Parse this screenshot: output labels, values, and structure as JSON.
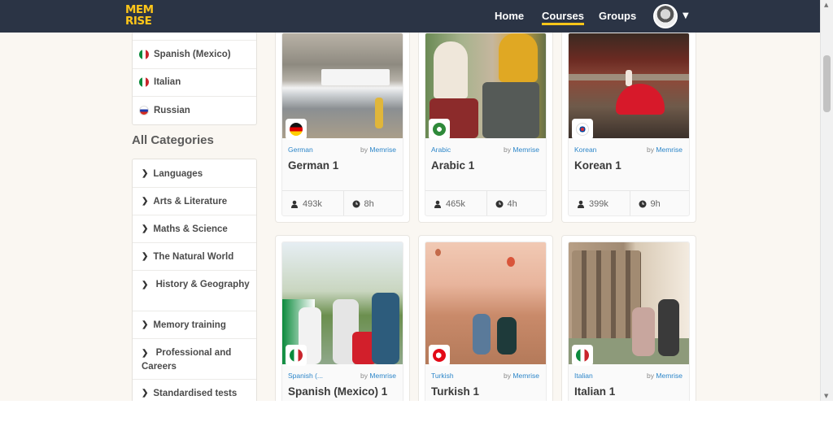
{
  "header": {
    "logo": "MEM RISE",
    "logo_top": "MEM",
    "logo_bottom": "RISE",
    "nav": [
      "Home",
      "Courses",
      "Groups"
    ],
    "active_nav": "Courses"
  },
  "sidebar": {
    "languages": [
      {
        "label": "Spanish (Mexico)",
        "flag": "mexico-flag-icon"
      },
      {
        "label": "Italian",
        "flag": "italy-flag-icon"
      },
      {
        "label": "Russian",
        "flag": "russia-flag-icon"
      }
    ],
    "categories_heading": "All Categories",
    "categories": [
      "Languages",
      "Arts & Literature",
      "Maths & Science",
      "The Natural World",
      "History & Geography",
      "Memory training",
      "Professional and Careers",
      "Standardised tests"
    ]
  },
  "courses": [
    {
      "category": "German",
      "by": "by",
      "author": "Memrise",
      "title": "German 1",
      "learners": "493k",
      "time": "8h",
      "flag": "germany-flag-icon"
    },
    {
      "category": "Arabic",
      "by": "by",
      "author": "Memrise",
      "title": "Arabic 1",
      "learners": "465k",
      "time": "4h",
      "flag": "arabic-flag-icon"
    },
    {
      "category": "Korean",
      "by": "by",
      "author": "Memrise",
      "title": "Korean 1",
      "learners": "399k",
      "time": "9h",
      "flag": "korea-flag-icon"
    },
    {
      "category": "Spanish (...",
      "by": "by",
      "author": "Memrise",
      "title": "Spanish (Mexico) 1",
      "flag": "mexico-flag-icon"
    },
    {
      "category": "Turkish",
      "by": "by",
      "author": "Memrise",
      "title": "Turkish 1",
      "flag": "turkey-flag-icon"
    },
    {
      "category": "Italian",
      "by": "by",
      "author": "Memrise",
      "title": "Italian 1",
      "flag": "italy-flag-icon"
    }
  ],
  "colors": {
    "navbar": "#2b3445",
    "brand_yellow": "#ffc619",
    "link_blue": "#2d86c9",
    "page_bg": "#faf7f2"
  }
}
